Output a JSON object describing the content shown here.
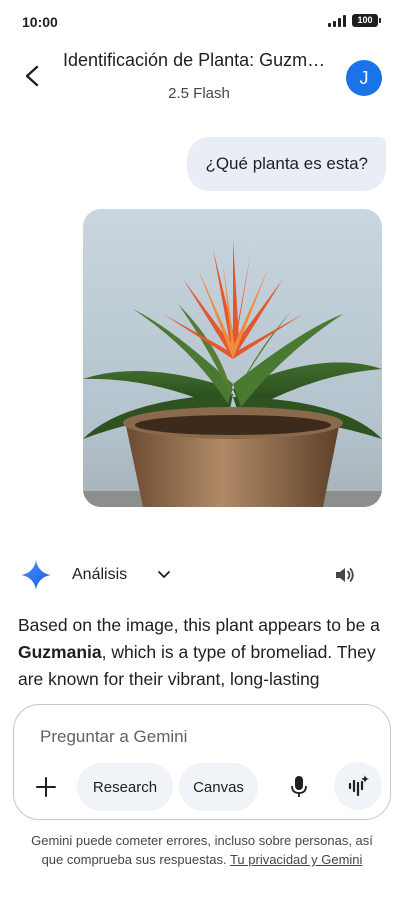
{
  "status_bar": {
    "time": "10:00",
    "battery": "100",
    "icons": [
      "signal-icon",
      "battery-icon"
    ]
  },
  "header": {
    "title": "Identificación de Planta: Guzmania",
    "subtitle": "2.5 Flash",
    "avatar_initial": "J",
    "avatar_color": "#1a73e8",
    "icons": [
      "back-arrow-icon"
    ]
  },
  "conversation": {
    "user_message": "¿Qué planta es esta?",
    "image_subject": "plant-photo"
  },
  "response": {
    "mode_label": "Análisis",
    "icons": [
      "gemini-sparkle-icon",
      "chevron-down-icon",
      "speaker-icon"
    ],
    "text_before": "Based on the image, this plant appears to be a ",
    "text_bold": "Guzmania",
    "text_after": ", which is a type of bromeliad. They are known for their vibrant, long-lasting"
  },
  "composer": {
    "placeholder": "Preguntar a Gemini",
    "research_label": "Research",
    "canvas_label": "Canvas",
    "icons": [
      "plus-icon",
      "microphone-icon",
      "live-audio-icon"
    ]
  },
  "disclaimer": {
    "text": "Gemini puede cometer errores, incluso sobre personas, así que comprueba sus respuestas. ",
    "link": "Tu privacidad y Gemini"
  },
  "colors": {
    "accent": "#1a73e8",
    "bubble_bg": "#e9eef6",
    "chip_bg": "#f0f4f9"
  }
}
